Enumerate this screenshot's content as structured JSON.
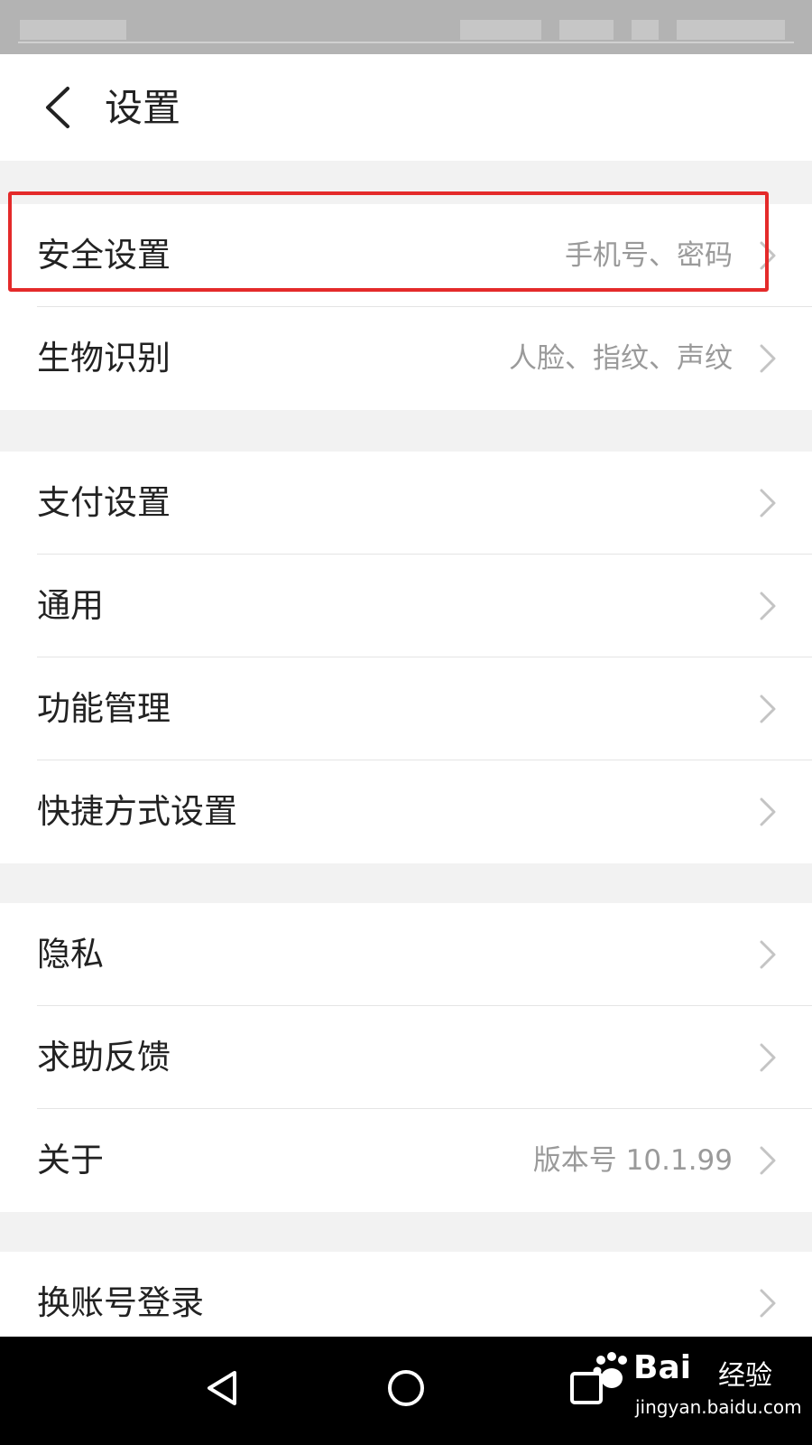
{
  "header": {
    "title": "设置"
  },
  "groups": [
    {
      "items": [
        {
          "label": "安全设置",
          "detail": "手机号、密码"
        },
        {
          "label": "生物识别",
          "detail": "人脸、指纹、声纹"
        }
      ]
    },
    {
      "items": [
        {
          "label": "支付设置",
          "detail": ""
        },
        {
          "label": "通用",
          "detail": ""
        },
        {
          "label": "功能管理",
          "detail": ""
        },
        {
          "label": "快捷方式设置",
          "detail": ""
        }
      ]
    },
    {
      "items": [
        {
          "label": "隐私",
          "detail": ""
        },
        {
          "label": "求助反馈",
          "detail": ""
        },
        {
          "label": "关于",
          "detail": "版本号 10.1.99"
        }
      ]
    },
    {
      "items": [
        {
          "label": "换账号登录",
          "detail": ""
        }
      ]
    }
  ],
  "highlight": {
    "target": "安全设置",
    "color": "#e42a2a"
  },
  "navbar": {
    "icons": [
      "back-triangle-icon",
      "home-circle-icon",
      "recents-square-icon"
    ]
  },
  "watermark": {
    "brand": "Bai",
    "brand_suffix": "经验",
    "url": "jingyan.baidu.com"
  }
}
